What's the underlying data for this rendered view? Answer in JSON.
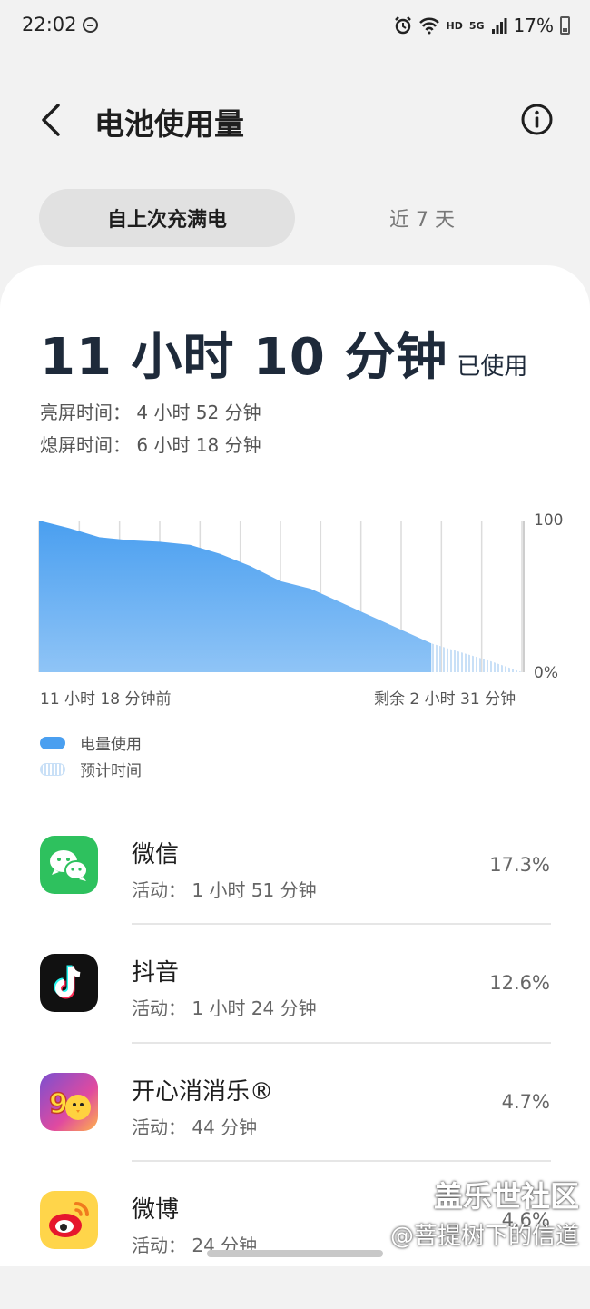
{
  "status_bar": {
    "time": "22:02",
    "battery_pct": "17%",
    "hd": "HD",
    "net": "5G"
  },
  "header": {
    "title": "电池使用量"
  },
  "tabs": [
    {
      "label": "自上次充满电",
      "active": true
    },
    {
      "label": "近 7 天",
      "active": false
    }
  ],
  "summary": {
    "total_big": "11 小时 10 分钟",
    "total_suffix": "已使用",
    "screen_on": "亮屏时间： 4 小时 52 分钟",
    "screen_off": "熄屏时间：  6 小时 18 分钟"
  },
  "chart_data": {
    "type": "area",
    "y_ticks": [
      "100",
      "0%"
    ],
    "x_labels": [
      "11 小时 18 分钟前",
      "剩余 2 小时 31 分钟"
    ],
    "ylim": [
      0,
      100
    ],
    "series": [
      {
        "name": "电量使用",
        "values": [
          100,
          95,
          89,
          87,
          86,
          84,
          78,
          70,
          60,
          55,
          46,
          37,
          28,
          19
        ]
      },
      {
        "name": "预计时间",
        "values": [
          19,
          13,
          7,
          0
        ]
      }
    ],
    "colors": {
      "usage": "#4a9ff0",
      "projection": "#c9e0f7"
    }
  },
  "legend": [
    {
      "label": "电量使用",
      "style": "solid"
    },
    {
      "label": "预计时间",
      "style": "dashed"
    }
  ],
  "apps": [
    {
      "name": "微信",
      "activity": "活动： 1 小时 51 分钟",
      "percent": "17.3%",
      "icon": "wechat-icon"
    },
    {
      "name": "抖音",
      "activity": "活动： 1 小时 24 分钟",
      "percent": "12.6%",
      "icon": "douyin-icon"
    },
    {
      "name": "开心消消乐®",
      "activity": "活动： 44 分钟",
      "percent": "4.7%",
      "icon": "happy-elimination-icon"
    },
    {
      "name": "微博",
      "activity": "活动： 24 分钟",
      "percent": "4.6%",
      "icon": "weibo-icon"
    }
  ],
  "watermark": {
    "line1": "盖乐世社区",
    "line2": "@菩提树下的信道"
  }
}
